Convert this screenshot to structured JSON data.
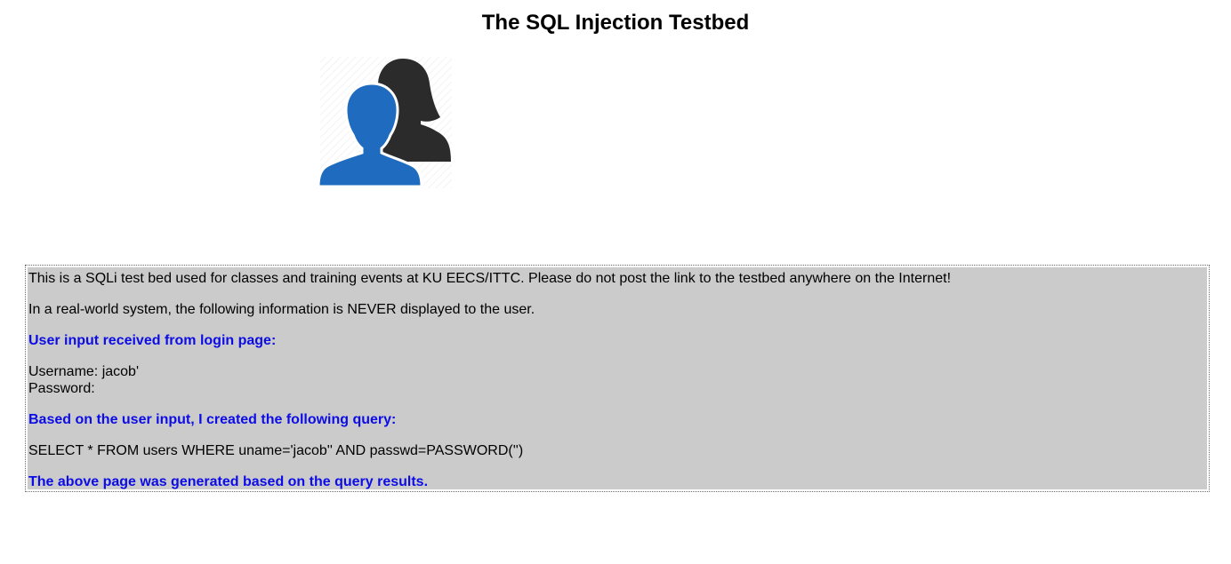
{
  "page": {
    "title": "The SQL Injection Testbed"
  },
  "image": {
    "icon": "users-icon",
    "colors": {
      "front_person": "#1e6bbf",
      "back_person": "#2b2b2b"
    }
  },
  "info": {
    "notice": "This is a SQLi test bed used for classes and training events at KU EECS/ITTC. Please do not post the link to the testbed anywhere on the Internet!",
    "warning": "In a real-world system, the following information is NEVER displayed to the user.",
    "input_heading": "User input received from login page:",
    "username_line": "Username: jacob'",
    "password_line": "Password:",
    "query_heading": "Based on the user input, I created the following query:",
    "query": "SELECT * FROM users WHERE uname='jacob'' AND passwd=PASSWORD('')",
    "result_note": "The above page was generated based on the query results."
  },
  "colors": {
    "box_background": "#cbcbcb",
    "heading_blue": "#0c0ce6"
  }
}
